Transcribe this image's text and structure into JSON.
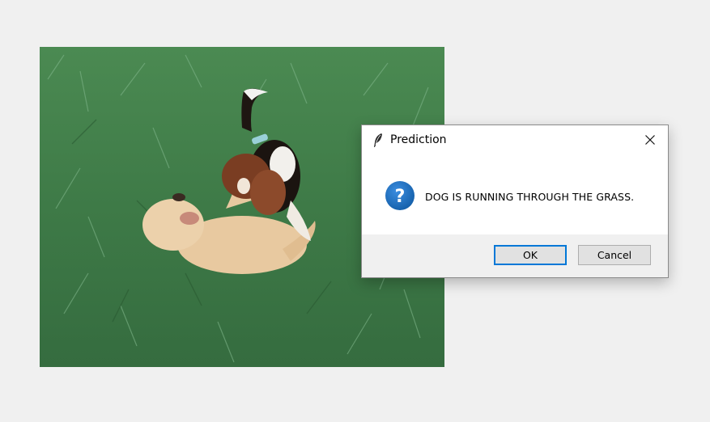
{
  "dialog": {
    "title": "Prediction",
    "message": "DOG IS RUNNING THROUGH THE GRASS.",
    "ok_label": "OK",
    "cancel_label": "Cancel",
    "icons": {
      "app": "feather-icon",
      "close": "close-icon",
      "message": "question-icon"
    },
    "colors": {
      "accent": "#0078d7",
      "question_icon": "#1a6fc2"
    }
  },
  "photo": {
    "subject": "dog-playing-image"
  }
}
